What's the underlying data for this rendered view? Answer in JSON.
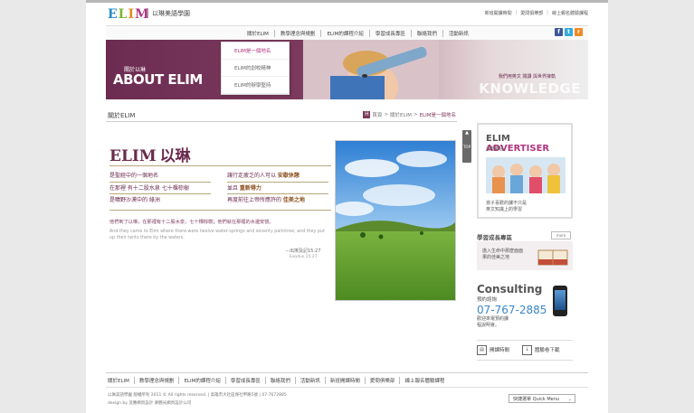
{
  "header": {
    "logo_text": "ELIM",
    "logo_letters": [
      {
        "ch": "E",
        "color": "#2a8cc8"
      },
      {
        "ch": "L",
        "color": "#7bb42c"
      },
      {
        "ch": "I",
        "color": "#e38c1f"
      },
      {
        "ch": "M",
        "color": "#b0357f"
      }
    ],
    "logo_subtitle": "以琳美語學園",
    "top_links": [
      "新班開課時間",
      "愛問俱樂部",
      "線上報名體驗課程"
    ]
  },
  "nav": {
    "items": [
      "關於ELIM",
      "教學理念與規劃",
      "ELIM的課程介紹",
      "學習成長專區",
      "聯絡我們",
      "活動新訊"
    ],
    "social": [
      {
        "name": "facebook",
        "glyph": "f",
        "color": "#3b5998"
      },
      {
        "name": "twitter",
        "glyph": "t",
        "color": "#33aadd"
      },
      {
        "name": "rss",
        "glyph": "r",
        "color": "#f08a24"
      }
    ]
  },
  "banner": {
    "about_cn": "關於以琳",
    "about_en": "ABOUT ELIM",
    "slogan": "我們用英文 閱讀 與世界接軌",
    "knowledge": "KNOWLEDGE"
  },
  "dropdown": {
    "items": [
      "ELIM是一個地名",
      "ELIM的創校精神",
      "ELIM的辦學堅持"
    ]
  },
  "content": {
    "section_title": "關於ELIM",
    "breadcrumb": [
      "首頁",
      "關於ELIM",
      "ELIM是一個地名"
    ],
    "elim_en": "ELIM",
    "elim_cn": "以琳",
    "verse_left": [
      "是聖經中的一個地名",
      "在那裡  有十二股水泉  七十棵棕樹",
      "是曠野沙漠中的  綠洲"
    ],
    "verse_right": [
      {
        "t": "讓行走疲乏的人可以 ",
        "b": "安歇休憩"
      },
      {
        "t": "並且 ",
        "b": "重新得力"
      },
      {
        "t": "再度前往上帝所應許的 ",
        "b": "佳美之地"
      }
    ],
    "quote_cn": "他們到了以琳，在那裡有十二股水泉，七十棵棕樹；他們就在那裡的水邊安營。",
    "quote_en": "And they came to Elim where there were twelve water-springs and seventy palmtree; and they put up their tents there by the waters.",
    "quote_src": "－出埃及記15:27",
    "quote_src_en": "Exodus 15:27",
    "scroll_label": "TOP"
  },
  "sidebar": {
    "adv_title_a": "ELIM ",
    "adv_title_b": "ADVERTISER",
    "adv_sub": "活動專區",
    "adv_caption": [
      "孩子喜歡的課不只是",
      "英文知識上的學習"
    ],
    "growth_title": "學習成長專區",
    "more": "more",
    "growth_text": [
      "擔入生命中那麼面面",
      "果的佳美之地"
    ],
    "consult_title": "Consulting",
    "consult_sub": "預約諮詢",
    "consult_phone": "07-767-2885",
    "consult_note": [
      "歡迎來電預約課",
      "程說明會。"
    ],
    "link1": "開課時間",
    "link2": "體驗卷下載"
  },
  "footer": {
    "nav": [
      "關於ELIM",
      "教學理念與規劃",
      "ELIM的課程介紹",
      "學習成長專區",
      "聯絡我們",
      "活動新訊",
      "新班開課時間",
      "愛問俱樂部",
      "線上報名體驗課程"
    ],
    "copyright": "以琳美語學園 版權所有 2011 © All rights reserved.  |  高雄市大社區保社甲路5號  |  07-7672885",
    "design": "design by 流應網頁設計 麥鶴光網頁設計公司",
    "quick_menu": "快捷選單 Quick Menu"
  }
}
